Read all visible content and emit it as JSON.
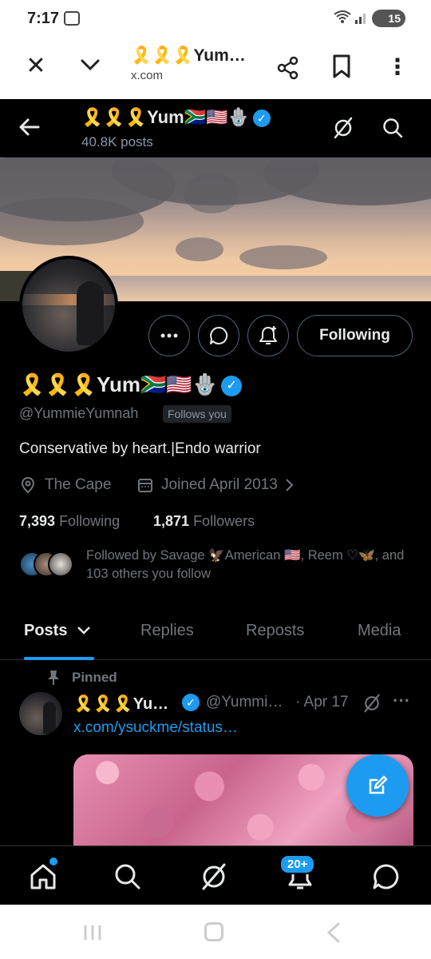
{
  "status_bar": {
    "time": "7:17",
    "battery": "15"
  },
  "custom_tab": {
    "title": "🎗️🎗️🎗️Yum…",
    "url": "x.com"
  },
  "profile_header": {
    "name": "🎗️🎗️🎗️Yum🇿🇦🇺🇸🪬",
    "post_count": "40.8K posts"
  },
  "profile": {
    "display_name": "🎗️🎗️🎗️Yum🇿🇦🇺🇸🪬",
    "handle": "@YummieYumnah",
    "follows_you": "Follows you",
    "bio": "Conservative by heart.|Endo warrior",
    "location": "The Cape",
    "joined": "Joined April 2013",
    "following_count": "7,393",
    "following_label": "Following",
    "followers_count": "1,871",
    "followers_label": "Followers",
    "followed_by": "Followed by Savage 🦅American 🇺🇸, Reem ♡🦋, and 103 others you follow",
    "following_button": "Following"
  },
  "tabs": [
    {
      "label": "Posts",
      "active": true
    },
    {
      "label": "Replies",
      "active": false
    },
    {
      "label": "Reposts",
      "active": false
    },
    {
      "label": "Media",
      "active": false
    }
  ],
  "pinned_post": {
    "pinned_label": "Pinned",
    "author_name": "🎗️🎗️🎗️Yu…",
    "author_handle": "@Yummi…",
    "date": "· Apr 17",
    "link_text": "x.com/ysuckme/status…"
  },
  "bottom_nav": {
    "notif_badge": "20+"
  },
  "colors": {
    "accent": "#1d9bf0",
    "background": "#000000",
    "muted": "#71767b"
  },
  "icons": [
    "close-icon",
    "chevron-down-icon",
    "share-icon",
    "bookmark-icon",
    "more-vert-icon",
    "back-arrow-icon",
    "grok-icon",
    "search-icon",
    "more-icon",
    "message-icon",
    "bell-plus-icon",
    "location-icon",
    "calendar-icon",
    "pin-icon",
    "compose-icon",
    "home-icon",
    "bell-icon"
  ]
}
